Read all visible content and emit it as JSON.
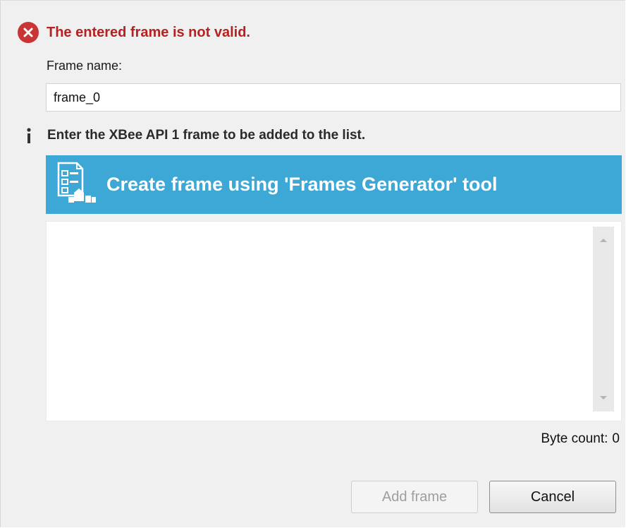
{
  "error": {
    "message": "The entered frame is not valid.",
    "icon": "error-circle-x-icon"
  },
  "frame_name": {
    "label": "Frame name:",
    "value": "frame_0"
  },
  "info": {
    "message": "Enter the XBee API 1 frame to be added to the list.",
    "icon": "info-icon"
  },
  "generator": {
    "label": "Create frame using 'Frames Generator' tool",
    "icon": "frames-generator-icon"
  },
  "byte_count": {
    "label": "Byte count:",
    "value": "0"
  },
  "buttons": {
    "add": "Add frame",
    "cancel": "Cancel"
  },
  "colors": {
    "accent": "#3da7d6",
    "error": "#c93535",
    "background": "#f0f0f0"
  }
}
